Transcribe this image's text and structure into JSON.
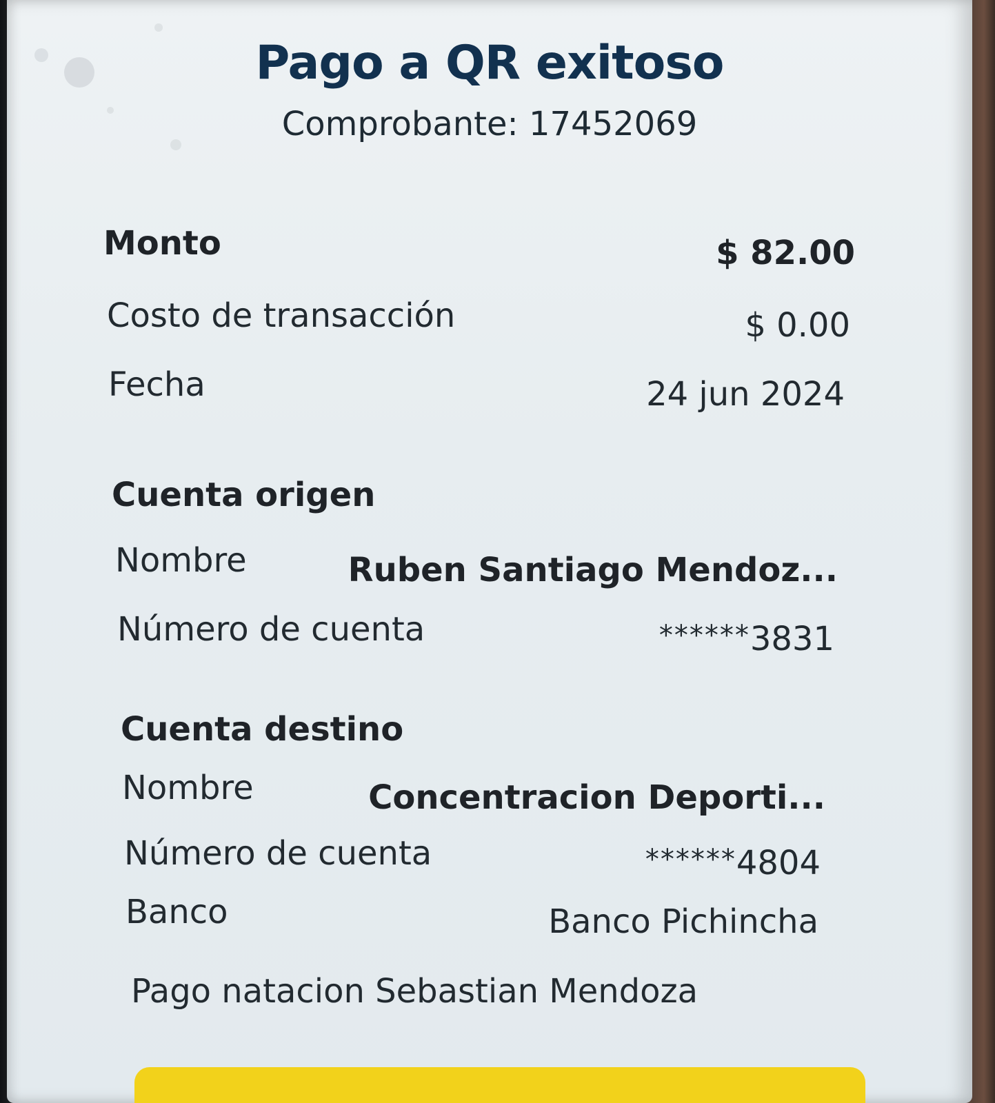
{
  "header": {
    "title": "Pago a QR exitoso",
    "receipt": "Comprobante: 17452069"
  },
  "summary": {
    "amount_label": "Monto",
    "amount_value": "$ 82.00",
    "fee_label": "Costo de transacción",
    "fee_value": "$ 0.00",
    "date_label": "Fecha",
    "date_value": "24 jun 2024"
  },
  "origin": {
    "section_title": "Cuenta origen",
    "name_label": "Nombre",
    "name_value": "Ruben Santiago Mendoz...",
    "account_label": "Número de cuenta",
    "account_mask": "******",
    "account_last4": "3831"
  },
  "destination": {
    "section_title": "Cuenta destino",
    "name_label": "Nombre",
    "name_value": "Concentracion Deporti...",
    "account_label": "Número de cuenta",
    "account_mask": "******",
    "account_last4": "4804",
    "bank_label": "Banco",
    "bank_value": "Banco Pichincha"
  },
  "memo": "Pago natacion Sebastian Mendoza",
  "colors": {
    "title": "#12314f",
    "text": "#222a30",
    "screen_bg": "#e7edf0",
    "button": "#f2d21b"
  }
}
